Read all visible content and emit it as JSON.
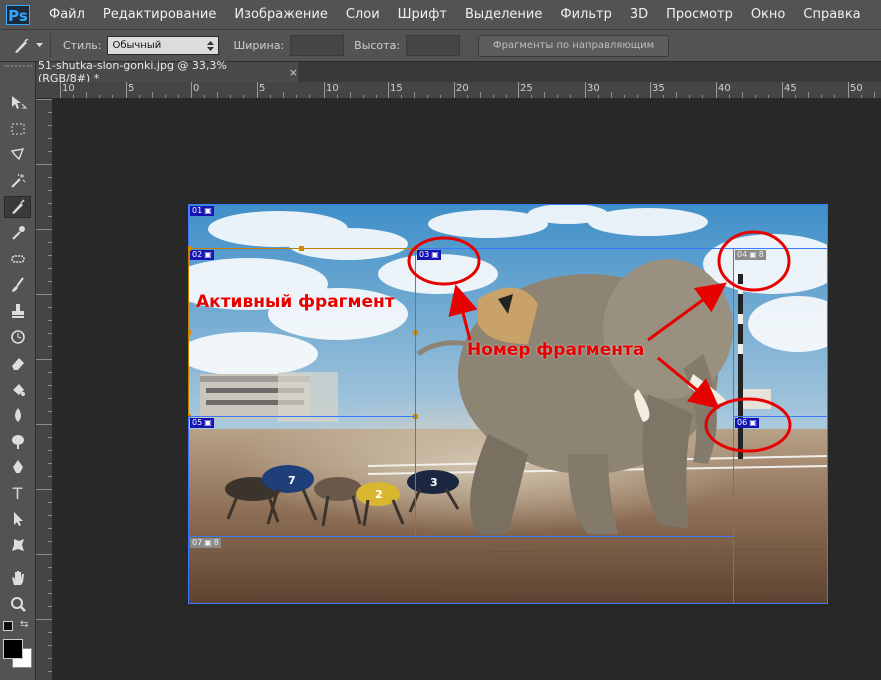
{
  "menubar": {
    "logo": "Ps",
    "items": [
      "Файл",
      "Редактирование",
      "Изображение",
      "Слои",
      "Шрифт",
      "Выделение",
      "Фильтр",
      "3D",
      "Просмотр",
      "Окно",
      "Справка"
    ]
  },
  "options": {
    "style_label": "Стиль:",
    "style_value": "Обычный",
    "width_label": "Ширина:",
    "height_label": "Высота:",
    "slices_button": "Фрагменты по направляющим"
  },
  "document": {
    "tab_title": "51-shutka-slon-gonki.jpg @ 33,3% (RGB/8#) *",
    "close_glyph": "×"
  },
  "ruler": {
    "labels": [
      "10",
      "5",
      "0",
      "5",
      "10",
      "15",
      "20",
      "25",
      "30",
      "35",
      "40",
      "45",
      "50"
    ]
  },
  "slices": {
    "s01": "01",
    "s02": "02",
    "s03": "03",
    "s04": "04",
    "s05": "05",
    "s06": "06",
    "s07": "07"
  },
  "annotations": {
    "active": "Активный фрагмент",
    "number": "Номер фрагмента"
  },
  "colors": {
    "accent": "#e60000",
    "slice_line": "#3a78ff",
    "active_slice": "#c08000"
  },
  "tools": [
    "move-tool",
    "marquee-tool",
    "lasso-tool",
    "magic-wand-tool",
    "slice-tool",
    "eyedropper-tool",
    "spot-heal-tool",
    "brush-tool",
    "stamp-tool",
    "history-brush-tool",
    "eraser-tool",
    "gradient-tool",
    "blur-tool",
    "dodge-tool",
    "pen-tool",
    "type-tool",
    "path-select-tool",
    "shape-tool",
    "hand-tool",
    "zoom-tool"
  ]
}
